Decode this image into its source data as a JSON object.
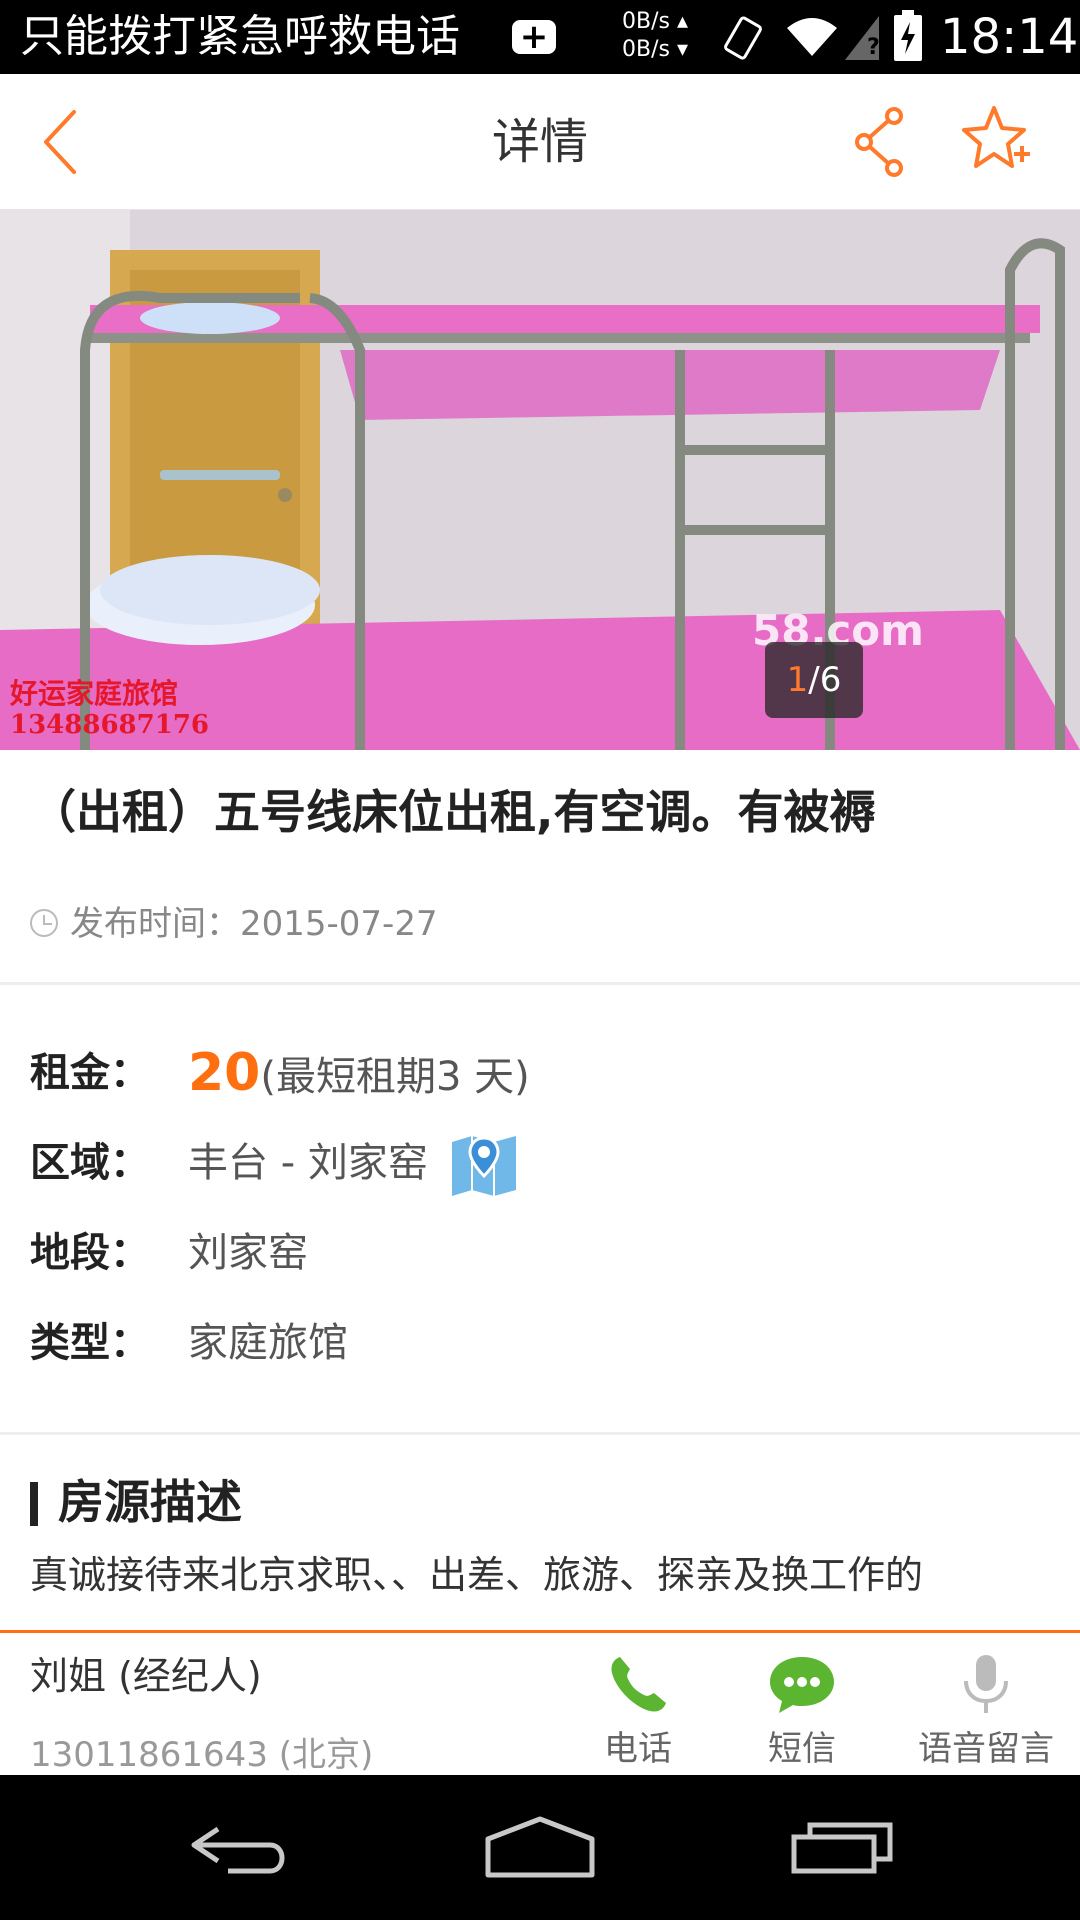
{
  "status_bar": {
    "notice": "只能拨打紧急呼救电话",
    "net_up": "0B/s",
    "net_down": "0B/s",
    "time": "18:14"
  },
  "top_bar": {
    "title": "详情",
    "accent_color": "#ff7a2a"
  },
  "gallery": {
    "current": "1",
    "separator": "/",
    "total": "6",
    "watermark_site": "58.com",
    "watermark_shop": "好运家庭旅馆",
    "watermark_phone": "13488687176"
  },
  "listing": {
    "title": "（出租）五号线床位出租,有空调。有被褥",
    "publish_label": "发布时间：",
    "publish_date": "2015-07-27"
  },
  "details": {
    "rent_label": "租金：",
    "rent_value": "20",
    "rent_note": "(最短租期3 天)",
    "area_label": "区域：",
    "area_value": "丰台 - 刘家窑",
    "section_label": "地段：",
    "section_value": "刘家窑",
    "type_label": "类型：",
    "type_value": "家庭旅馆"
  },
  "description": {
    "heading": "房源描述",
    "text": "真诚接待来北京求职、、出差、旅游、探亲及换工作的"
  },
  "contact": {
    "name": "刘姐 (经纪人)",
    "phone": "13011861643 (北京)",
    "call_label": "电话",
    "sms_label": "短信",
    "voice_label": "语音留言",
    "call_color": "#5cb531",
    "sms_color": "#5cb531",
    "voice_color": "#bbbbbb"
  }
}
